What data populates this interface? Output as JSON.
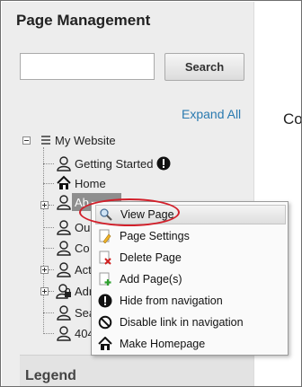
{
  "panel": {
    "title": "Page Management",
    "search_placeholder": "",
    "search_button": "Search",
    "expand_all": "Expand All",
    "legend_title": "Legend"
  },
  "right_panel": {
    "text": "Co"
  },
  "tree": {
    "root": "My Website",
    "nodes": [
      {
        "label": "Getting Started",
        "icon": "user-icon",
        "badge": "exclamation-icon"
      },
      {
        "label": "Home",
        "icon": "home-icon"
      },
      {
        "label": "Ab",
        "icon": "user-icon",
        "selected": true
      },
      {
        "label": "Ou",
        "icon": "user-icon"
      },
      {
        "label": "Co",
        "icon": "user-icon"
      },
      {
        "label": "Act",
        "icon": "user-icon"
      },
      {
        "label": "Adr",
        "icon": "user-lock-icon"
      },
      {
        "label": "Sea",
        "icon": "user-icon"
      },
      {
        "label": "404",
        "icon": "user-icon"
      }
    ]
  },
  "context_menu": {
    "items": [
      {
        "label": "View Page",
        "icon": "magnifier-icon",
        "highlighted": true
      },
      {
        "label": "Page Settings",
        "icon": "page-settings-icon"
      },
      {
        "label": "Delete Page",
        "icon": "delete-page-icon"
      },
      {
        "label": "Add Page(s)",
        "icon": "add-page-icon"
      },
      {
        "label": "Hide from navigation",
        "icon": "exclamation-icon"
      },
      {
        "label": "Disable link in navigation",
        "icon": "no-entry-icon"
      },
      {
        "label": "Make Homepage",
        "icon": "home-icon"
      }
    ]
  },
  "colors": {
    "highlight_ellipse": "#d21f2a",
    "link": "#2a7ab0",
    "selected_node": "#8e8e8e"
  }
}
